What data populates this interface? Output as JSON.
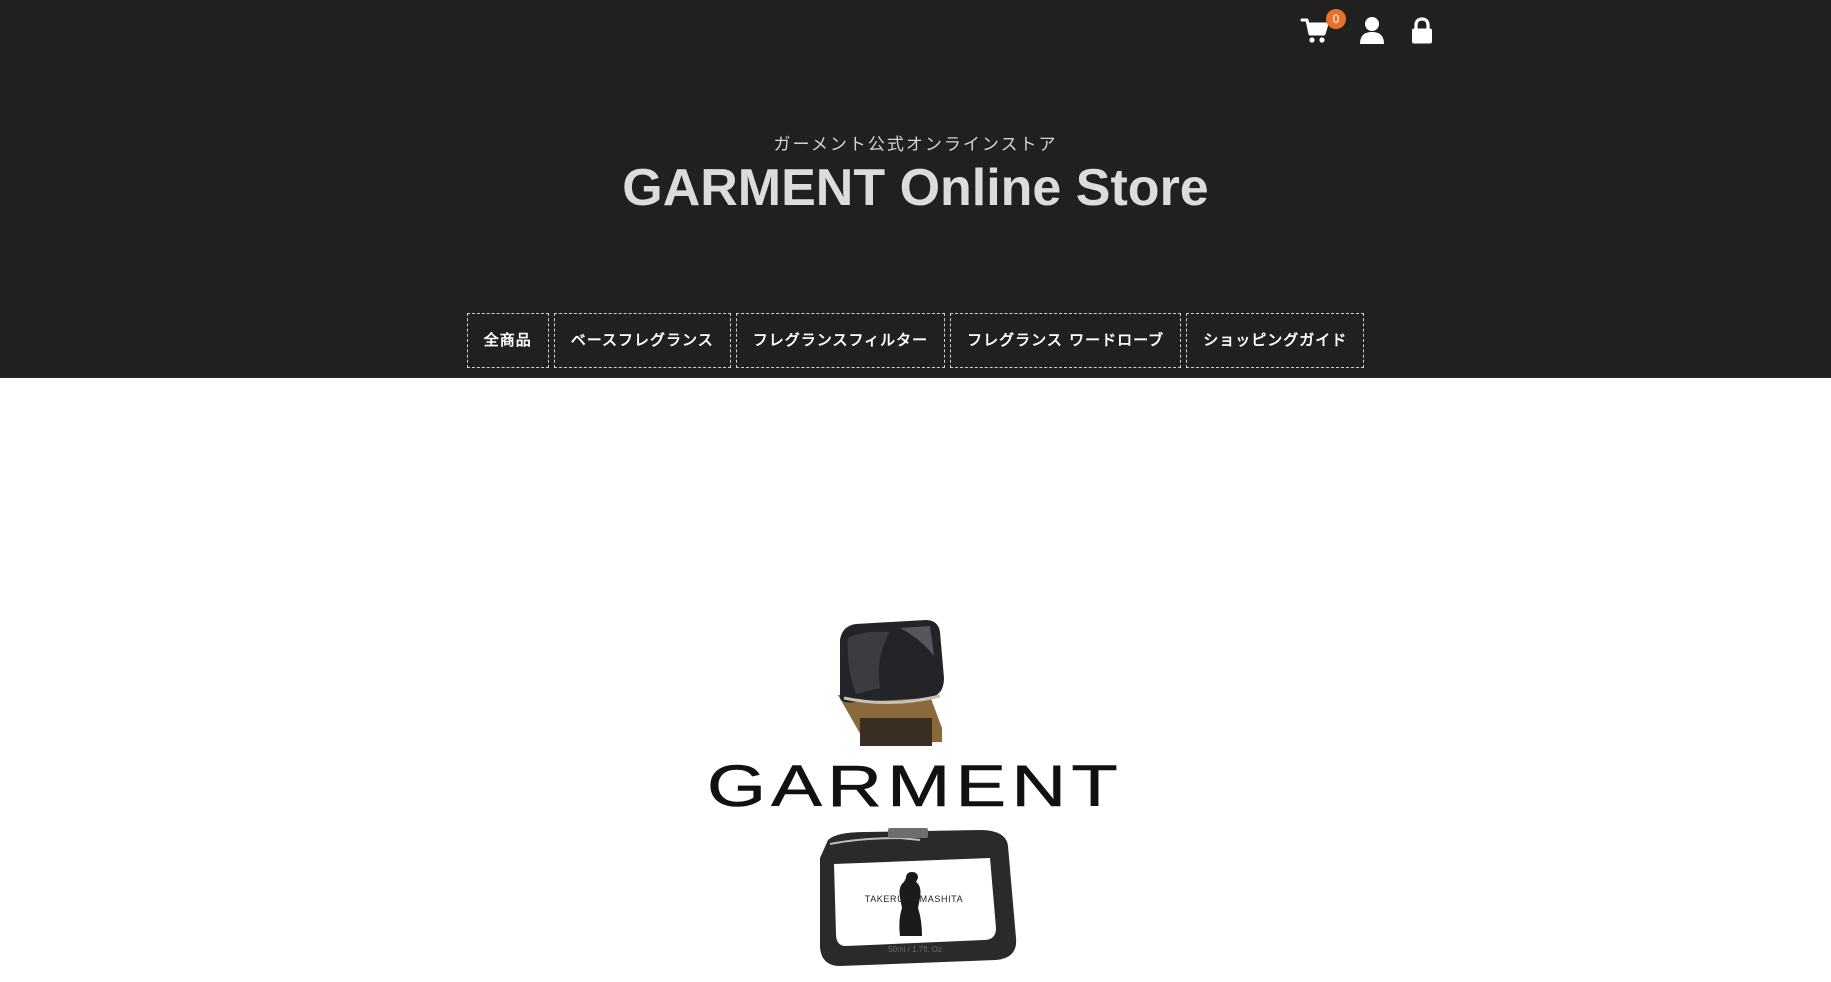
{
  "header": {
    "subtitle": "ガーメント公式オンラインストア",
    "title": "GARMENT Online Store",
    "cart_count": "0",
    "icons": [
      "cart-icon",
      "user-icon",
      "lock-icon"
    ],
    "background_color": "#202020",
    "badge_color": "#e8722c"
  },
  "nav": {
    "items": [
      {
        "label": "全商品"
      },
      {
        "label": "ベースフレグランス"
      },
      {
        "label": "フレグランスフィルター"
      },
      {
        "label": "フレグランス ワードローブ"
      },
      {
        "label": "ショッピングガイド"
      }
    ]
  },
  "hero": {
    "brand_wordmark": "GARMENT",
    "bottle_label": "TAKERU YAMASHITA",
    "bottle_volume": "50ml / 1.7fl. Oz"
  }
}
